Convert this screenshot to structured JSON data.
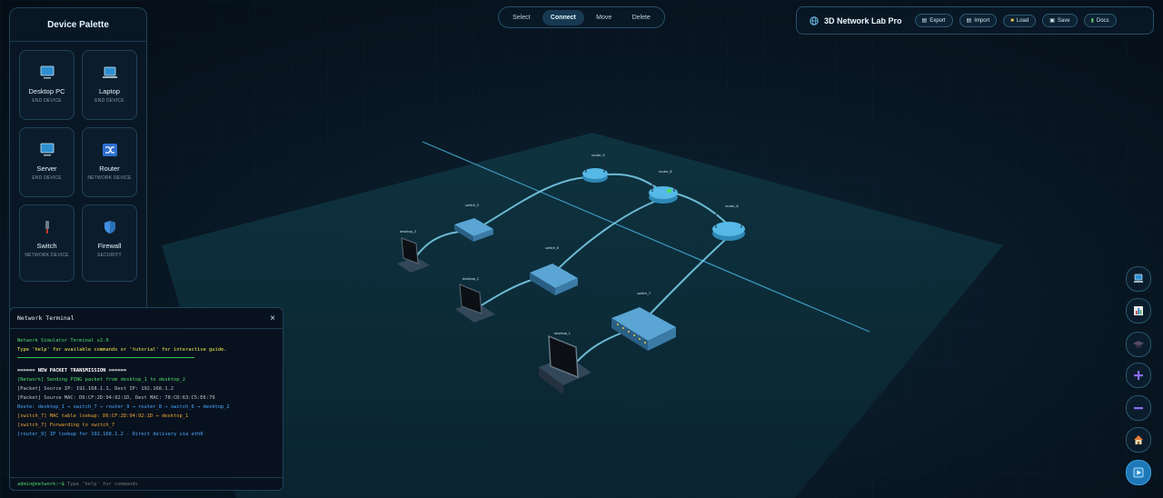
{
  "palette": {
    "title": "Device Palette",
    "items": [
      {
        "name": "Desktop PC",
        "category": "END DEVICE",
        "icon": "desktop-icon"
      },
      {
        "name": "Laptop",
        "category": "END DEVICE",
        "icon": "laptop-icon"
      },
      {
        "name": "Server",
        "category": "END DEVICE",
        "icon": "server-icon"
      },
      {
        "name": "Router",
        "category": "NETWORK DEVICE",
        "icon": "router-icon"
      },
      {
        "name": "Switch",
        "category": "NETWORK DEVICE",
        "icon": "switch-icon"
      },
      {
        "name": "Firewall",
        "category": "SECURITY",
        "icon": "firewall-icon"
      }
    ]
  },
  "modes": {
    "items": [
      "Select",
      "Connect",
      "Move",
      "Delete"
    ],
    "active": "Connect"
  },
  "header": {
    "title": "3D Network Lab Pro",
    "buttons": [
      "Export",
      "Import",
      "Load",
      "Save",
      "Docs"
    ]
  },
  "terminal": {
    "title": "Network Terminal",
    "close": "×",
    "intro": [
      "Network Simulator Terminal v2.0",
      "Type 'help' for available commands or 'tutorial' for interactive guide."
    ],
    "lines": [
      {
        "text": "====== NEW PACKET TRANSMISSION ======",
        "color": "#ffffff"
      },
      {
        "text": "[Network] Sending PING packet from desktop_1 to desktop_2",
        "color": "#4fd968"
      },
      {
        "text": "[Packet] Source IP: 192.168.1.1, Dest IP: 192.168.1.2",
        "color": "#b9c6cd"
      },
      {
        "text": "[Packet] Source MAC: D6:CF:2D:94:92:1D, Dest MAC: 78:CD:63:C5:E6:79",
        "color": "#b9c6cd"
      },
      {
        "text": "Route: desktop_1 → switch_7 → router_9 → router_8 → switch_6 → desktop_2",
        "color": "#4aa8ff"
      },
      {
        "text": "[switch_7] MAC table lookup: D6:CF:2D:94:92:1D → desktop_1",
        "color": "#f0a531"
      },
      {
        "text": "[switch_7] Forwarding to switch_7",
        "color": "#f0a531"
      },
      {
        "text": "[router_9] IP lookup for 192.168.1.2 - Direct delivery via eth0",
        "color": "#4aa8ff"
      }
    ],
    "prompt": "admin@network:~$",
    "placeholder": "Type 'help' for commands"
  },
  "scene": {
    "labels": [
      "router_9",
      "router_8",
      "router_6",
      "switch_5",
      "switch_6",
      "switch_7",
      "desktop_3",
      "desktop_2",
      "desktop_1"
    ]
  },
  "tools": [
    "laptop-icon",
    "chart-icon",
    "graduation-cap-icon",
    "zoom-in-icon",
    "zoom-out-icon",
    "home-icon",
    "play-icon"
  ],
  "colors": {
    "accent": "#1e78b8",
    "cable": "#7fd3f0",
    "floor": "#0f3a48"
  }
}
